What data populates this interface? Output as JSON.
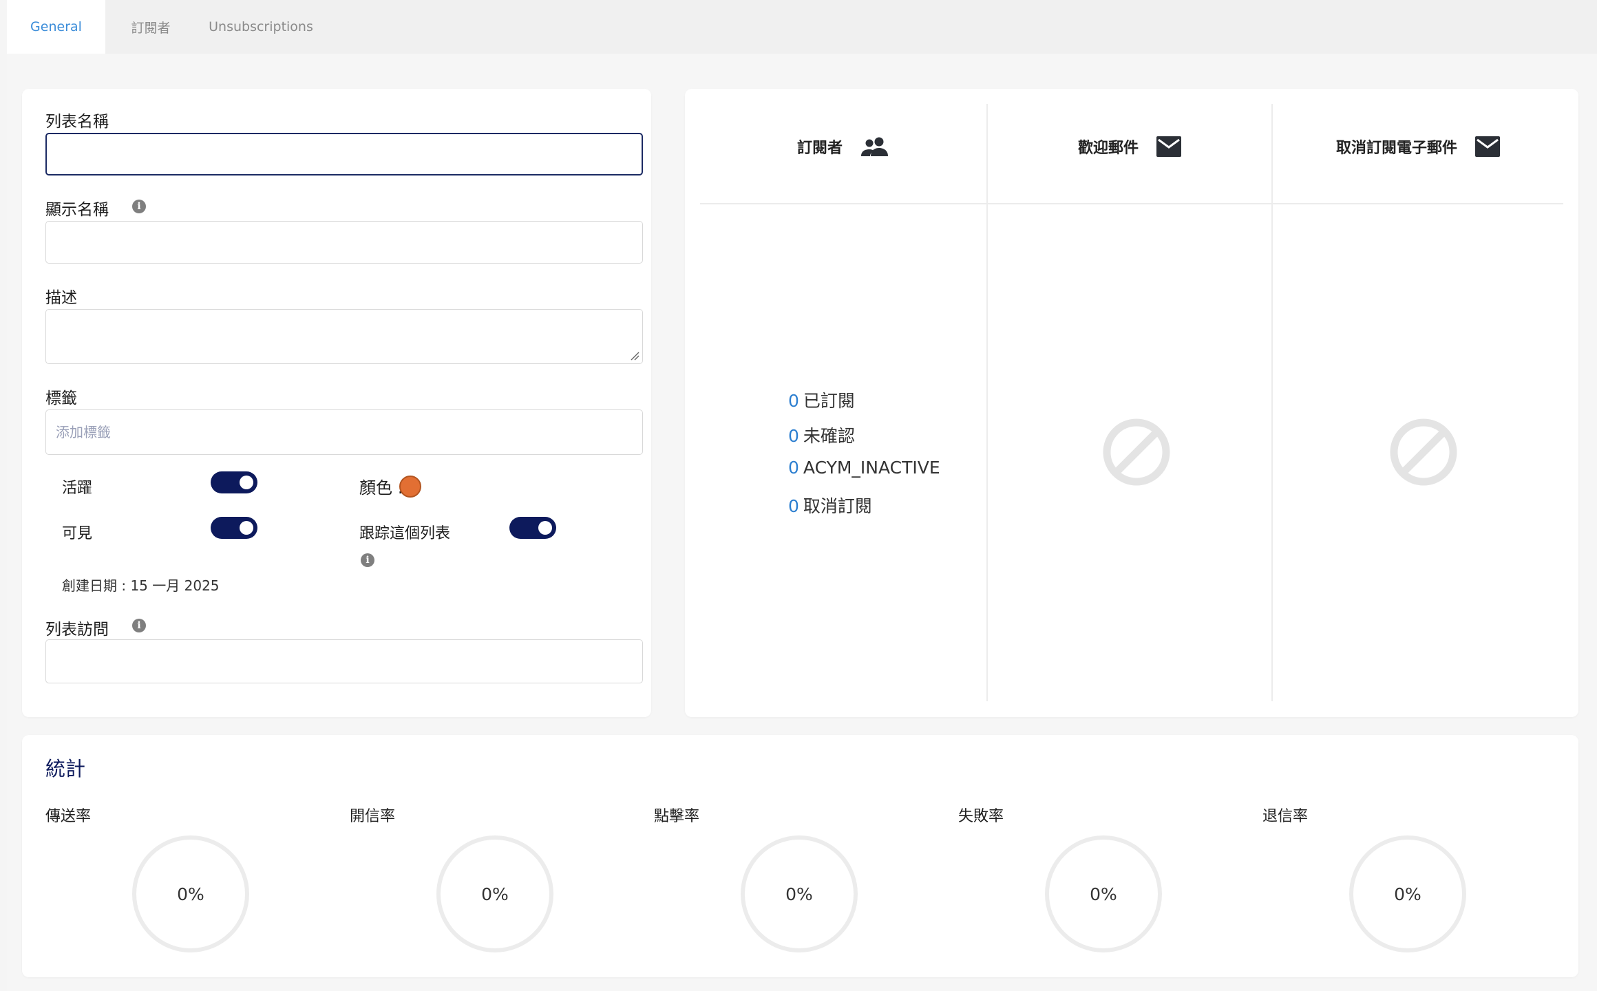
{
  "tabs": [
    {
      "label": "General",
      "active": true
    },
    {
      "label": "訂閱者",
      "active": false
    },
    {
      "label": "Unsubscriptions",
      "active": false
    }
  ],
  "form": {
    "list_name_label": "列表名稱",
    "list_name_value": "",
    "display_name_label": "顯示名稱",
    "display_name_value": "",
    "description_label": "描述",
    "description_value": "",
    "tags_label": "標籤",
    "tags_placeholder": "添加標籤",
    "active_label": "活躍",
    "active_on": true,
    "visible_label": "可見",
    "visible_on": true,
    "color_label": "顏色 :",
    "color_value": "#e26f33",
    "track_label": "跟踪這個列表",
    "track_on": true,
    "created_label": "創建日期 : 15 一月 2025",
    "access_label": "列表訪問",
    "access_value": "",
    "info_glyph": "i"
  },
  "summary": {
    "subscribers_header": "訂閱者",
    "welcome_header": "歡迎郵件",
    "unsub_email_header": "取消訂閱電子郵件",
    "counts": [
      {
        "num": "0",
        "label": "已訂閱"
      },
      {
        "num": "0",
        "label": "未確認"
      },
      {
        "num": "0",
        "label": "ACYM_INACTIVE"
      },
      {
        "num": "0",
        "label": "取消訂閱"
      }
    ],
    "icons": {
      "subscribers": "users-icon",
      "welcome": "envelope-icon",
      "unsub": "envelope-icon",
      "empty": "ban-icon"
    }
  },
  "stats": {
    "title": "統計",
    "items": [
      {
        "label": "傳送率",
        "value": "0%"
      },
      {
        "label": "開信率",
        "value": "0%"
      },
      {
        "label": "點擊率",
        "value": "0%"
      },
      {
        "label": "失敗率",
        "value": "0%"
      },
      {
        "label": "退信率",
        "value": "0%"
      }
    ]
  },
  "colors": {
    "accent": "#3c8dd9",
    "toggle_on": "#0d1a5c",
    "count_number": "#2d7fd0"
  }
}
